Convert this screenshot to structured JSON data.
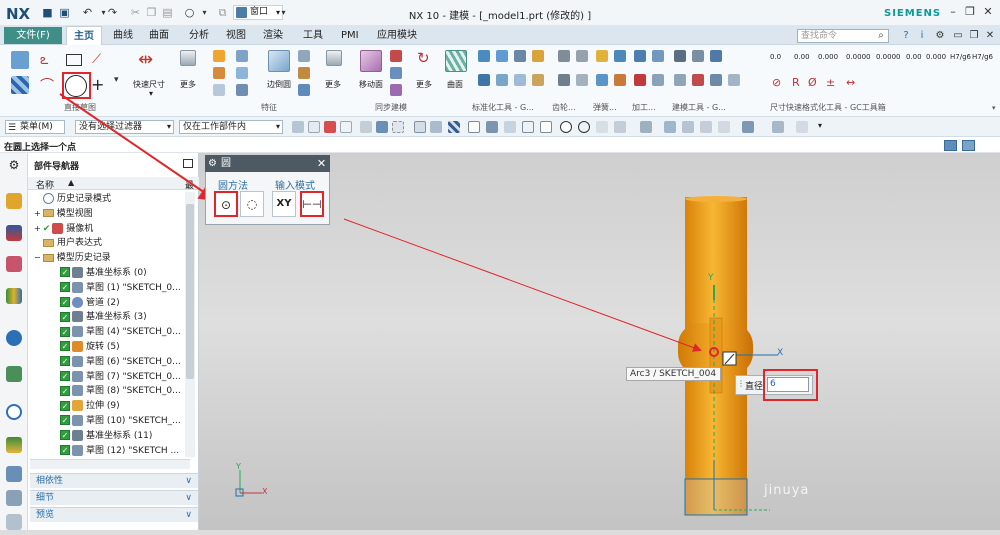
{
  "app": {
    "logo": "NX",
    "window_title": "NX 10 - 建模 - [_model1.prt  (修改的) ]",
    "brand": "SIEMENS",
    "window_menu": "窗口"
  },
  "menu": {
    "file": "文件(F)",
    "tabs": [
      "主页",
      "曲线",
      "曲面",
      "分析",
      "视图",
      "渲染",
      "工具",
      "PMI",
      "应用模块"
    ],
    "search_placeholder": "查找命令"
  },
  "ribbon": {
    "groups": [
      "直接草图",
      "特征",
      "同步建模",
      "标准化工具 - G...",
      "齿轮...",
      "弹簧...",
      "加工...",
      "建模工具 - G...",
      "尺寸快速格式化工具 - GC工具箱"
    ],
    "labels": {
      "quick_dim": "快速尺寸",
      "more1": "更多",
      "edge_blend": "边倒圆",
      "more2": "更多",
      "move_face": "移动面",
      "more3": "更多",
      "surface": "曲面"
    },
    "dim_codes": [
      "0.0",
      "0.00",
      "0.000",
      "0.0000",
      "0.0000",
      "0.00",
      "0.000",
      "H7/g6",
      "H7/g6"
    ]
  },
  "toolbar": {
    "menu": "菜单(M)",
    "filter": "没有选择过滤器",
    "scope": "仅在工作部件内"
  },
  "status": {
    "prompt": "在圆上选择一个点"
  },
  "navigator": {
    "title": "部件导航器",
    "column": "名称",
    "column_short": "最",
    "items": [
      {
        "label": "历史记录模式",
        "type": "plain"
      },
      {
        "label": "模型视图",
        "type": "folder"
      },
      {
        "label": "摄像机",
        "type": "check-folder"
      },
      {
        "label": "用户表达式",
        "type": "folder"
      },
      {
        "label": "模型历史记录",
        "type": "folder"
      },
      {
        "label": "基准坐标系 (0)",
        "type": "feature"
      },
      {
        "label": "草图 (1) \"SKETCH_0...",
        "type": "feature"
      },
      {
        "label": "管道 (2)",
        "type": "feature"
      },
      {
        "label": "基准坐标系 (3)",
        "type": "feature"
      },
      {
        "label": "草图 (4) \"SKETCH_0...",
        "type": "feature"
      },
      {
        "label": "旋转 (5)",
        "type": "feature"
      },
      {
        "label": "草图 (6) \"SKETCH_0...",
        "type": "feature"
      },
      {
        "label": "草图 (7) \"SKETCH_0...",
        "type": "feature"
      },
      {
        "label": "草图 (8) \"SKETCH_0...",
        "type": "feature"
      },
      {
        "label": "拉伸 (9)",
        "type": "feature"
      },
      {
        "label": "草图 (10) \"SKETCH_...",
        "type": "feature"
      },
      {
        "label": "基准坐标系 (11)",
        "type": "feature"
      },
      {
        "label": "草图 (12) \"SKETCH ...",
        "type": "feature"
      }
    ],
    "panels": [
      "相依性",
      "细节",
      "预览"
    ]
  },
  "dialog": {
    "title": "圆",
    "method_label": "圆方法",
    "input_label": "输入模式",
    "xy_label": "XY"
  },
  "viewport": {
    "tooltip": "Arc3 / SKETCH_004",
    "diameter_label": "直径",
    "diameter_value": "6",
    "axis_x": "X",
    "axis_y": "Y",
    "watermark": "jinuya"
  },
  "colors": {
    "body": "#f2a117",
    "body_dark": "#d9820a",
    "accent": "#3f8f88",
    "annotation": "#e0262a"
  }
}
